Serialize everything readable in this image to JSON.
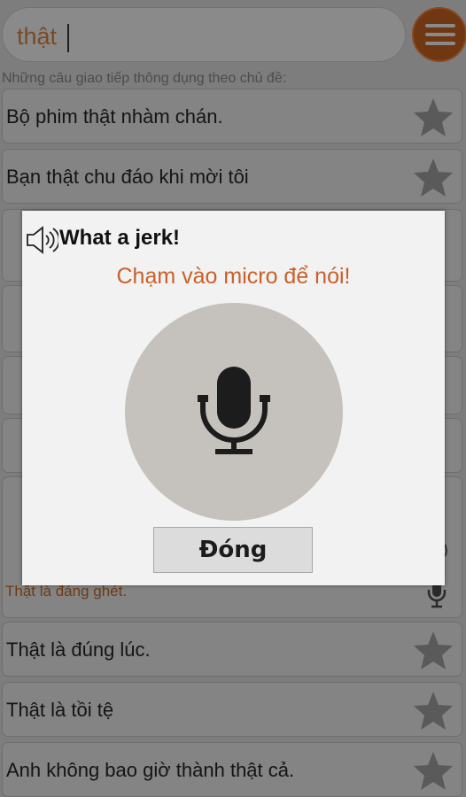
{
  "search": {
    "value": "thật"
  },
  "header": {
    "menu_icon": "hamburger-menu-icon",
    "subtitle": "Những câu giao tiếp thông dụng theo chủ đề:"
  },
  "list": {
    "items": [
      {
        "text": "Bộ phim thật nhàm chán."
      },
      {
        "text": "Bạn thật chu đáo khi mời tôi"
      },
      {
        "text": "Thật là đúng lúc."
      },
      {
        "text": "Thật là tồi tệ"
      },
      {
        "text": "Anh không bao giờ thành thật cả."
      }
    ],
    "expanded": {
      "vi": "Thật là đáng ghét."
    }
  },
  "dialog": {
    "title": "What a jerk!",
    "prompt": "Chạm vào micro để nói!",
    "close_label": "Đóng"
  },
  "colors": {
    "accent": "#c8602a",
    "menu_button": "#6f3712"
  }
}
